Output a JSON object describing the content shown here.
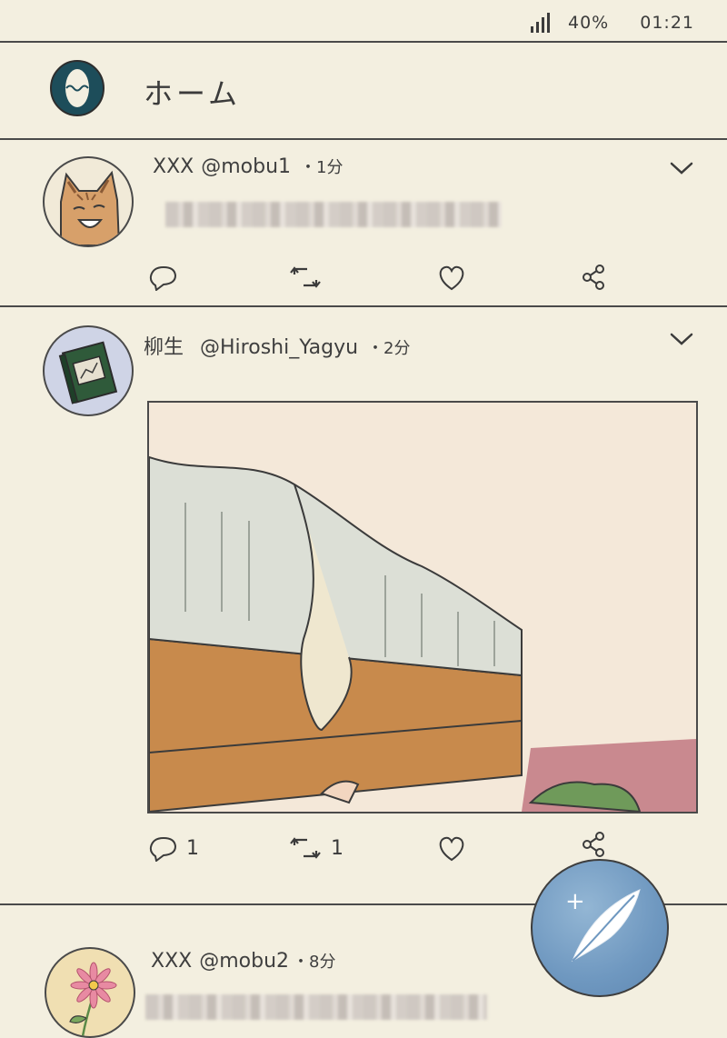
{
  "status_bar": {
    "battery": "40%",
    "time": "01:21"
  },
  "header": {
    "title": "ホーム"
  },
  "posts": [
    {
      "name": "XXX",
      "handle": "@mobu1",
      "time": "・1分",
      "avatar": "cat-avatar"
    },
    {
      "name": "柳生",
      "handle": "@Hiroshi_Yagyu",
      "time": "・2分",
      "avatar": "book-avatar",
      "reply_count": "1",
      "retweet_count": "1",
      "image": "bed-illustration"
    },
    {
      "name": "XXX",
      "handle": "@mobu2",
      "time": "・8分",
      "avatar": "flower-avatar"
    }
  ],
  "fab": {
    "icon": "quill-icon",
    "plus": "+"
  },
  "colors": {
    "background": "#f3efe0",
    "line": "#4a4a4a",
    "fab": "#6f98c0"
  }
}
